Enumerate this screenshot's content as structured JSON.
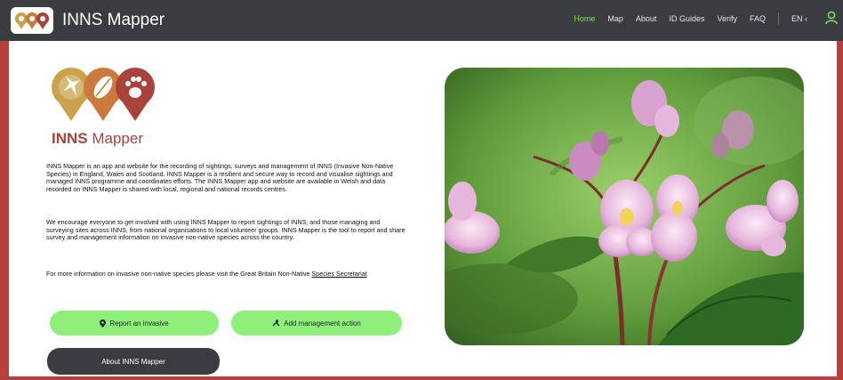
{
  "navbar": {
    "brand_name": "INNS Mapper",
    "links": [
      "Home",
      "Map",
      "About",
      "ID Guides",
      "Verify",
      "FAQ"
    ],
    "language": "EN ‹",
    "user_icon": "user-icon"
  },
  "hero": {
    "logo_text_bold": "INNS",
    "logo_text_regular": " Mapper",
    "paragraph1": "INNS Mapper is an app and website for the recording of sightings, surveys and management of INNS (Invasive Non-Native Species) in England, Wales and Scotland. INNS Mapper is a resilient and secure way to record and visualise sightings and managed INNS programme and coordinates efforts. The INNS Mapper app and website are available in Welsh and data recorded on INNS Mapper is shared with local, regional and national records centres.",
    "paragraph2": "We encourage everyone to get involved with using INNS Mapper to report sightings of INNS, and those managing and surveying sites across INNS, from national organisations to local volunteer groups. INNS Mapper is the tool to report and share survey and management information on invasive non-native species across the country.",
    "paragraph3_text": "For more information on invasive non-native species please visit the Great Britain Non-Native ",
    "paragraph3_link": "Species Secretariat",
    "buttons": {
      "report": "Report an invasive",
      "manage": "Add management action",
      "about": "About INNS Mapper"
    },
    "icons": {
      "report": "map-pin-icon",
      "manage": "tools-icon"
    }
  },
  "colors": {
    "frame": "#b8403a",
    "navbar": "#3a3c3f",
    "active_link": "#7ee05a",
    "green_button": "#8ef07a",
    "dark_button": "#3a3c3f",
    "logo_gold": "#c9a24a",
    "logo_orange": "#cc7a3c",
    "logo_red": "#a8423b"
  }
}
